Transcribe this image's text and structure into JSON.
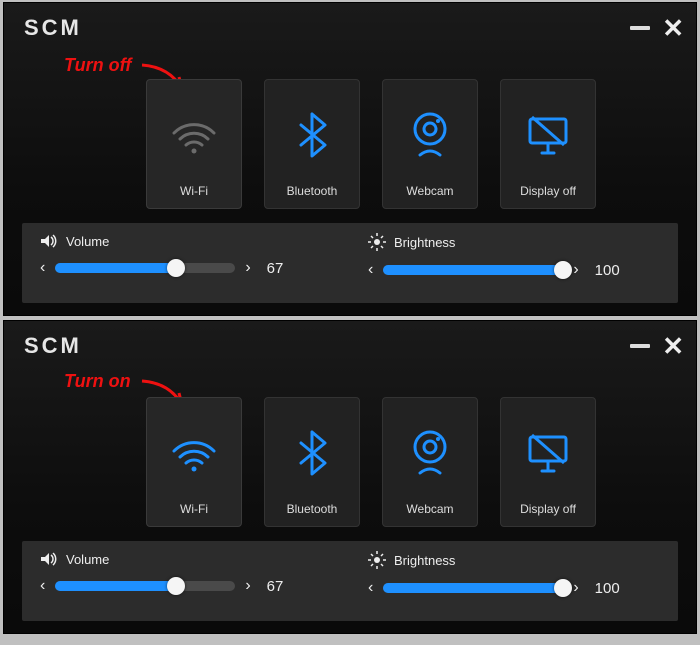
{
  "panels": [
    {
      "logo": "SCM",
      "annotation": "Turn off",
      "tiles": [
        {
          "key": "wifi",
          "label": "Wi-Fi",
          "icon": "wifi-icon",
          "active": false
        },
        {
          "key": "bluetooth",
          "label": "Bluetooth",
          "icon": "bluetooth-icon",
          "active": true
        },
        {
          "key": "webcam",
          "label": "Webcam",
          "icon": "webcam-icon",
          "active": true
        },
        {
          "key": "displayoff",
          "label": "Display off",
          "icon": "display-off-icon",
          "active": true
        }
      ],
      "volume": {
        "label": "Volume",
        "value": 67,
        "min": 0,
        "max": 100
      },
      "brightness": {
        "label": "Brightness",
        "value": 100,
        "min": 0,
        "max": 100
      }
    },
    {
      "logo": "SCM",
      "annotation": "Turn on",
      "tiles": [
        {
          "key": "wifi",
          "label": "Wi-Fi",
          "icon": "wifi-icon",
          "active": true
        },
        {
          "key": "bluetooth",
          "label": "Bluetooth",
          "icon": "bluetooth-icon",
          "active": true
        },
        {
          "key": "webcam",
          "label": "Webcam",
          "icon": "webcam-icon",
          "active": true
        },
        {
          "key": "displayoff",
          "label": "Display off",
          "icon": "display-off-icon",
          "active": true
        }
      ],
      "volume": {
        "label": "Volume",
        "value": 67,
        "min": 0,
        "max": 100
      },
      "brightness": {
        "label": "Brightness",
        "value": 100,
        "min": 0,
        "max": 100
      }
    }
  ],
  "colors": {
    "accent": "#1e90ff",
    "inactive": "#6b6b6b"
  }
}
